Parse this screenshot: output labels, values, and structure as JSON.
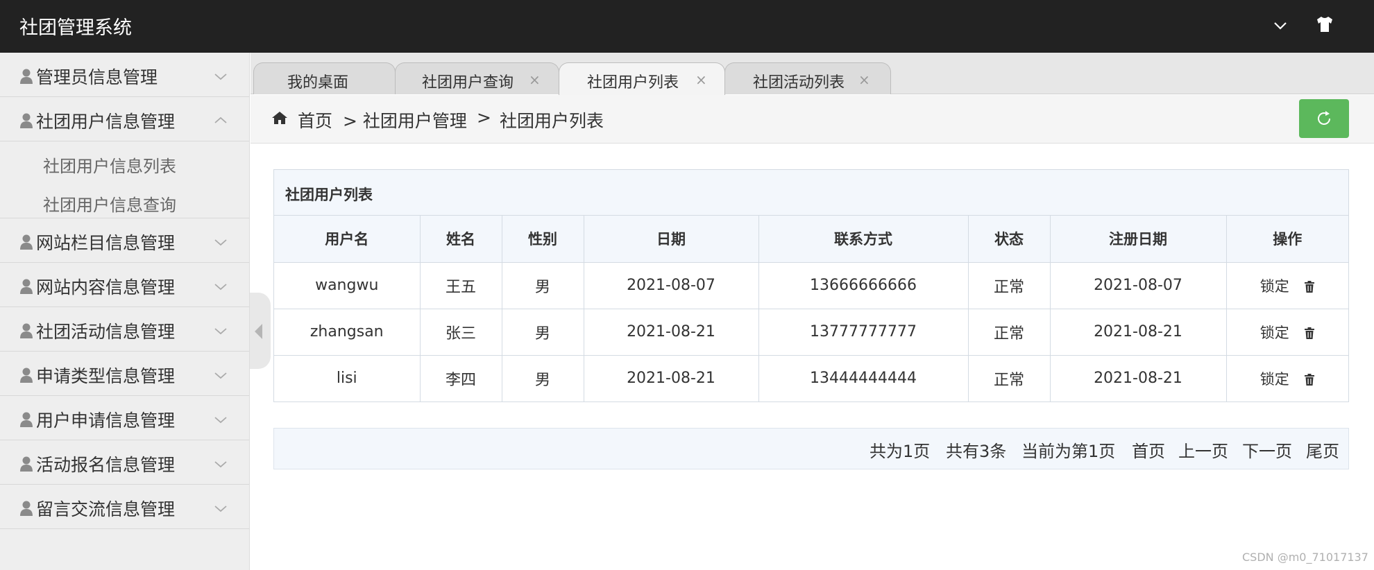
{
  "header": {
    "title": "社团管理系统",
    "icons": [
      "chevron-down-icon",
      "tshirt-icon"
    ]
  },
  "sidebar": {
    "items": [
      {
        "label": "管理员信息管理",
        "expanded": false
      },
      {
        "label": "社团用户信息管理",
        "expanded": true,
        "children": [
          "社团用户信息列表",
          "社团用户信息查询"
        ]
      },
      {
        "label": "网站栏目信息管理",
        "expanded": false
      },
      {
        "label": "网站内容信息管理",
        "expanded": false
      },
      {
        "label": "社团活动信息管理",
        "expanded": false
      },
      {
        "label": "申请类型信息管理",
        "expanded": false
      },
      {
        "label": "用户申请信息管理",
        "expanded": false
      },
      {
        "label": "活动报名信息管理",
        "expanded": false
      },
      {
        "label": "留言交流信息管理",
        "expanded": false
      }
    ]
  },
  "tabs": [
    {
      "label": "我的桌面",
      "closable": false,
      "active": false
    },
    {
      "label": "社团用户查询",
      "closable": true,
      "active": false
    },
    {
      "label": "社团用户列表",
      "closable": true,
      "active": true
    },
    {
      "label": "社团活动列表",
      "closable": true,
      "active": false
    }
  ],
  "close_glyph": "×",
  "breadcrumb": {
    "items": [
      "首页",
      "> 社团用户管理",
      ">",
      "社团用户列表"
    ]
  },
  "panel": {
    "title": "社团用户列表",
    "columns": [
      "用户名",
      "姓名",
      "性别",
      "日期",
      "联系方式",
      "状态",
      "注册日期",
      "操作"
    ],
    "rows": [
      {
        "username": "wangwu",
        "name": "王五",
        "gender": "男",
        "date": "2021-08-07",
        "phone": "13666666666",
        "status": "正常",
        "reg_date": "2021-08-07",
        "action": "锁定"
      },
      {
        "username": "zhangsan",
        "name": "张三",
        "gender": "男",
        "date": "2021-08-21",
        "phone": "13777777777",
        "status": "正常",
        "reg_date": "2021-08-21",
        "action": "锁定"
      },
      {
        "username": "lisi",
        "name": "李四",
        "gender": "男",
        "date": "2021-08-21",
        "phone": "13444444444",
        "status": "正常",
        "reg_date": "2021-08-21",
        "action": "锁定"
      }
    ]
  },
  "pager": {
    "total_pages": "共为1页",
    "total_records": "共有3条",
    "current": "当前为第1页",
    "first": "首页",
    "prev": "上一页",
    "next": "下一页",
    "last": "尾页"
  },
  "watermark": "CSDN @m0_71017137",
  "colors": {
    "header_bg": "#222222",
    "refresh_btn": "#5cb85c",
    "panel_head": "#f3f7fc"
  }
}
